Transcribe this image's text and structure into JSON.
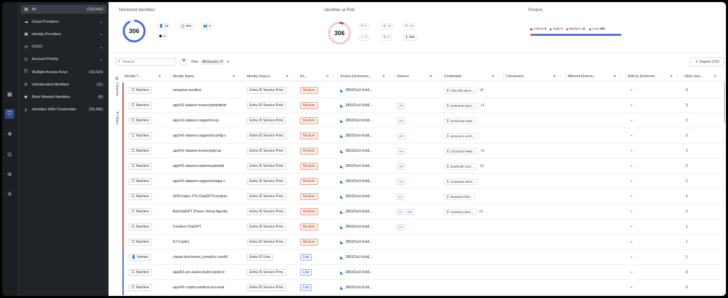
{
  "sidebar": {
    "items": [
      {
        "label": "All",
        "count": "(133,542)",
        "icon": "grid-icon",
        "active": true
      },
      {
        "label": "Cloud Providers",
        "chevron": "⌄",
        "icon": "cloud-icon"
      },
      {
        "label": "Identity Providers",
        "chevron": "⌄",
        "icon": "id-icon"
      },
      {
        "label": "CI/CD",
        "chevron": "⌄",
        "icon": "pipeline-icon"
      },
      {
        "label": "Account Priority",
        "chevron": "⌄",
        "icon": "priority-icon"
      },
      {
        "label": "Multiple Access Keys",
        "count": "(16,615)",
        "icon": "keys-icon"
      },
      {
        "label": "Unfederated Identities",
        "count": "(11)",
        "icon": "unlink-icon"
      },
      {
        "label": "Most Wanted Identities",
        "count": "(8)",
        "icon": "diamond-icon"
      },
      {
        "label": "Identities With Credentials",
        "count": "(29,436)",
        "icon": "key-icon"
      }
    ]
  },
  "monitored": {
    "title": "Monitored Identities",
    "value": "306",
    "chips": [
      {
        "icon": "👤",
        "value": "13"
      },
      {
        "icon": "🖵",
        "value": "293"
      },
      {
        "icon": "👥",
        "value": "0"
      },
      {
        "icon": "⬢",
        "value": "0"
      }
    ]
  },
  "atrisk": {
    "title": "Identities at Risk",
    "value": "306",
    "chips": [
      {
        "icon": "⚲",
        "value": "0"
      },
      {
        "icon": "⊘",
        "value": "13"
      },
      {
        "icon": "⟳",
        "value": "13"
      },
      {
        "icon": "▭",
        "value": "0"
      },
      {
        "icon": "⚙",
        "value": "0"
      },
      {
        "icon": "⚷",
        "value": "306"
      }
    ]
  },
  "posture": {
    "title": "Posture",
    "legend": [
      {
        "label": "Critical",
        "value": "0",
        "color": "#b91c1c"
      },
      {
        "label": "High",
        "value": "0",
        "color": "#ea580c"
      },
      {
        "label": "Medium",
        "value": "11",
        "color": "#e5533d"
      },
      {
        "label": "Low",
        "value": "295",
        "color": "#5b6ee1"
      }
    ],
    "medium_fraction": 0.036
  },
  "toolbar": {
    "search_placeholder": "Search",
    "filter_label": "Risk",
    "filter_value": "All Access, H",
    "filter_clear": "✕",
    "export_label": "Export CSV"
  },
  "side_tabs": {
    "columns": "Columns",
    "filters": "Filters"
  },
  "columns": [
    "Identity T...",
    "Identity Name",
    "Identity Source",
    "Po...",
    "Source Environme...",
    "Owners",
    "Credentials",
    "Consumers",
    "Affected Environ...",
    "Risk by Environm...",
    "Open Issu..."
  ],
  "rows": [
    {
      "type": "Machine",
      "name": "vmoperat-sandbox",
      "source": "Entra ID Service Princ",
      "posture": "Medium",
      "env": "289321e0-9cb6...",
      "owners": [],
      "cred": "03bc2df1-8bca-...",
      "cred_more": "+2",
      "issues": "4"
    },
    {
      "type": "Machine",
      "name": "app541-dataext-movecopilotwithdo",
      "source": "Entra ID Service Princ",
      "posture": "Medium",
      "env": "289321e0-9cb6...",
      "owners": [
        "AP"
      ],
      "cred": "0e0b304d-dac1-...",
      "cred_more": "+1",
      "issues": "3"
    },
    {
      "type": "Machine",
      "name": "app141-dataext-capgemini-sp",
      "source": "Entra ID Service Princ",
      "posture": "Medium",
      "env": "289321e0-9cb6...",
      "owners": [
        "AP"
      ],
      "cred": "e52d41a5-94ab-...",
      "cred_more": "",
      "issues": "2"
    },
    {
      "type": "Machine",
      "name": "app341-dataext-capgeminiconfig-s",
      "source": "Entra ID Service Princ",
      "posture": "Medium",
      "env": "289321e0-9cb6...",
      "owners": [
        "AP"
      ],
      "cred": "4e02edc1-a104-...",
      "cred_more": "",
      "issues": "2"
    },
    {
      "type": "Machine",
      "name": "app541-dataext-movecopilot-sp",
      "source": "Entra ID Service Princ",
      "posture": "Medium",
      "env": "289321e0-9cb6...",
      "owners": [
        "AP"
      ],
      "cred": "1d1d3192-5665-...",
      "cred_more": "+1",
      "issues": "2"
    },
    {
      "type": "Machine",
      "name": "app541-dataext-ramtestcopilotabl",
      "source": "Entra ID Service Princ",
      "posture": "Medium",
      "env": "289321e0-9cb6...",
      "owners": [
        "AP"
      ],
      "cred": "63a0f1d9-1431-...",
      "cred_more": "+1",
      "issues": "2"
    },
    {
      "type": "Machine",
      "name": "app341-dataext-capgeministage-s",
      "source": "Entra ID Service Princ",
      "posture": "Medium",
      "env": "289321e0-9cb6...",
      "owners": [
        "AP"
      ],
      "cred": "d125eab4-39c5-...",
      "cred_more": "",
      "issues": "2"
    },
    {
      "type": "Machine",
      "name": "SPN-Fabric-ITS-ChatGPTComplian",
      "source": "Entra ID Service Princ",
      "posture": "Medium",
      "env": "289321e0-9cb6...",
      "owners": [
        "IA"
      ],
      "cred": "f50e952d-fb0f-...",
      "cred_more": "",
      "issues": "2"
    },
    {
      "type": "Machine",
      "name": "BotChatGPT (Power Virtual Agents)",
      "source": "Entra ID Service Princ",
      "posture": "Medium",
      "env": "289321e0-9cb6...",
      "owners": [
        "JJ",
        "PD"
      ],
      "cred": "6193f162-4f4e-...",
      "cred_more": "+1",
      "issues": "2"
    },
    {
      "type": "Machine",
      "name": "Ceridian ChatGPT",
      "source": "Entra ID Service Princ",
      "posture": "Medium",
      "env": "289321e0-9cb6...",
      "owners": [
        "CF"
      ],
      "cred": "",
      "cred_more": "",
      "issues": "1"
    },
    {
      "type": "Machine",
      "name": "K2 Copilot",
      "source": "Entra ID Service Princ",
      "posture": "Medium",
      "env": "289321e0-9cb6...",
      "owners": [],
      "cred": "",
      "cred_more": "",
      "issues": "1"
    },
    {
      "type": "Human",
      "name": "claude.deschenes_komplice.com#E",
      "source": "Entra ID User",
      "posture": "Low",
      "env": "289321e0-9cb6...",
      "owners": [],
      "cred": "",
      "cred_more": "",
      "issues": "1"
    },
    {
      "type": "Machine",
      "name": "app361-pro-avalos-build-copilot-d",
      "source": "Entra ID Service Princ",
      "posture": "Low",
      "env": "289321e0-9cb6...",
      "owners": [],
      "cred": "",
      "cred_more": "",
      "issues": "0"
    },
    {
      "type": "Machine",
      "name": "app341-copilot-sandbox-text-anal",
      "source": "Entra ID Service Princ",
      "posture": "Low",
      "env": "289321e0-9cb6...",
      "owners": [],
      "cred": "",
      "cred_more": "",
      "issues": "0"
    }
  ],
  "colors": {
    "medium": "#e5533d",
    "low": "#5b6ee1",
    "active_rail": "#2f4b86"
  }
}
